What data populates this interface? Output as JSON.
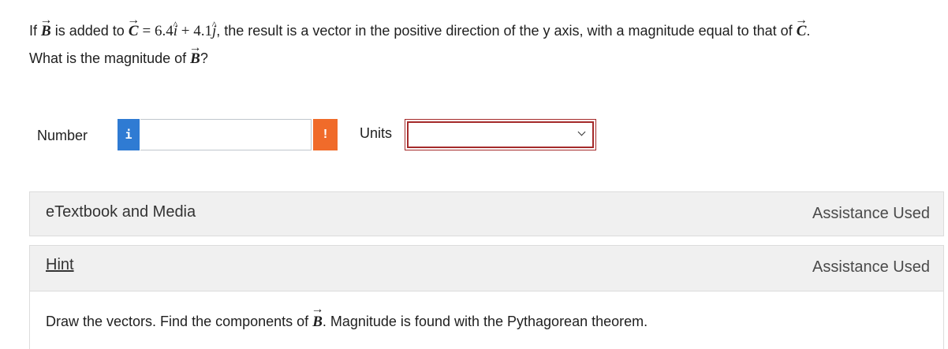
{
  "question": {
    "line1_if": "If",
    "vec_B": "B",
    "line1_added_to": "is added to",
    "vec_C": "C",
    "equals": "=",
    "coef_x": "6.4",
    "unit_i": "i",
    "plus": "+",
    "coef_y": "4.1",
    "unit_j": "j",
    "line1_rest": ", the result is a vector in the positive direction of the y axis, with a magnitude equal to that of",
    "period": ".",
    "line2_prefix": "What is the magnitude of",
    "line2_suffix": "?"
  },
  "answer": {
    "number_label": "Number",
    "info_icon_glyph": "i",
    "number_value": "",
    "warning_icon_glyph": "!",
    "units_label": "Units",
    "units_selected": ""
  },
  "panels": {
    "etextbook": {
      "title": "eTextbook and Media",
      "status": "Assistance Used"
    },
    "hint": {
      "title": "Hint",
      "status": "Assistance Used",
      "body_prefix": "Draw the vectors. Find the components of",
      "body_vec": "B",
      "body_suffix": ". Magnitude is found with the Pythagorean theorem."
    }
  },
  "colors": {
    "info_blue": "#2f7bd3",
    "warning_orange": "#f06b2a",
    "error_border": "#a52a2a",
    "panel_bg": "#f0f0f0"
  }
}
